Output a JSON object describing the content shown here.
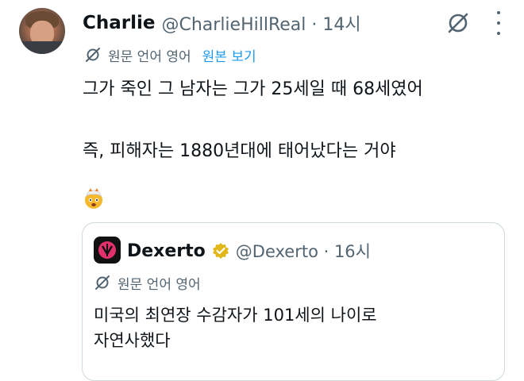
{
  "tweet": {
    "display_name": "Charlie",
    "handle_time": "@CharlieHillReal · 14시",
    "translate_label": "원문 언어 영어",
    "show_original": "원본 보기",
    "lines": [
      "그가 죽인 그 남자는 그가 25세일 때 68세였어",
      "즉, 피해자는 1880년대에 태어났다는 거야"
    ],
    "emoji_icon": "exploding-head-emoji"
  },
  "quoted": {
    "display_name": "Dexerto",
    "handle_time": "@Dexerto · 16시",
    "translate_label": "원문 언어 영어",
    "lines": [
      "미국의 최연장 수감자가 101세의 나이로",
      "자연사했다"
    ]
  },
  "icons": {
    "grok": "grok-icon",
    "more": "more-icon",
    "translate": "translate-icon",
    "verified": "verified-badge-icon"
  },
  "colors": {
    "link": "#1d9bf0",
    "secondary_text": "#536471",
    "verified_badge": "#e2b719",
    "dexerto_logo": "#e1306c"
  }
}
